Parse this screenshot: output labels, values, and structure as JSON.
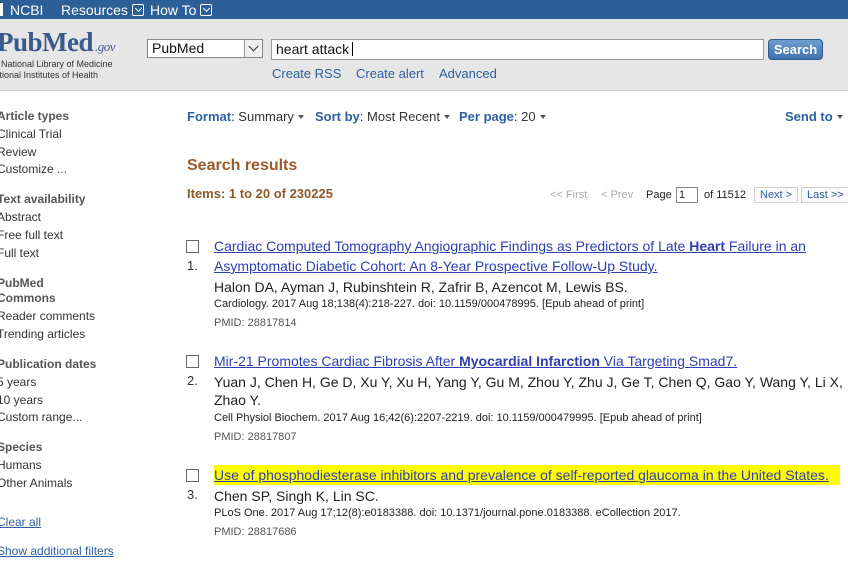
{
  "topbar": {
    "ncbi": "NCBI",
    "resources": "Resources",
    "howto": "How To"
  },
  "logo": {
    "name": "PubMed",
    "suffix": ".gov",
    "org1": "US National Library of Medicine",
    "org2": "National Institutes of Health"
  },
  "search": {
    "database": "PubMed",
    "query": "heart attack",
    "button": "Search"
  },
  "sublinks": {
    "rss": "Create RSS",
    "alert": "Create alert",
    "advanced": "Advanced"
  },
  "sidebar": {
    "article_types": {
      "heading": "Article types",
      "items": [
        "Clinical Trial",
        "Review",
        "Customize ..."
      ]
    },
    "text_availability": {
      "heading": "Text availability",
      "items": [
        "Abstract",
        "Free full text",
        "Full text"
      ]
    },
    "pubmed_commons": {
      "heading1": "PubMed",
      "heading2": "Commons",
      "items": [
        "Reader comments",
        "Trending articles"
      ]
    },
    "publication_dates": {
      "heading": "Publication dates",
      "items": [
        "5 years",
        "10 years",
        "Custom range..."
      ]
    },
    "species": {
      "heading": "Species",
      "items": [
        "Humans",
        "Other Animals"
      ]
    },
    "clear_all": "Clear all",
    "show_filters": "Show additional filters"
  },
  "toolbar": {
    "format_label": "Format",
    "format_sep": ": ",
    "format_value": "Summary",
    "sort_label": "Sort by",
    "sort_sep": ": ",
    "sort_value": "Most Recent",
    "perpage_label": "Per page",
    "perpage_sep": ": ",
    "perpage_value": "20",
    "sendto": "Send to"
  },
  "results": {
    "title": "Search results",
    "items_label": "Items: 1 to 20 of 230225",
    "pager": {
      "first": "<< First",
      "prev": "< Prev",
      "page_label": "Page",
      "page_value": "1",
      "of_label": "of 11512",
      "next": "Next >",
      "last": "Last >>"
    },
    "entries": [
      {
        "num": "1.",
        "title_a": "Cardiac Computed Tomography Angiographic Findings as Predictors of Late ",
        "title_bold": "Heart",
        "title_b": " Failure in an Asymptomatic Diabetic Cohort: An 8-Year Prospective Follow-Up Study.",
        "authors": "Halon DA, Ayman J, Rubinshtein R, Zafrir B, Azencot M, Lewis BS.",
        "citation": "Cardiology. 2017 Aug 18;138(4):218-227. doi: 10.1159/000478995. [Epub ahead of print]",
        "pmid": "PMID: 28817814"
      },
      {
        "num": "2.",
        "title_a": "Mir-21 Promotes Cardiac Fibrosis After ",
        "title_bold": "Myocardial Infarction",
        "title_b": " Via Targeting Smad7.",
        "authors": "Yuan J, Chen H, Ge D, Xu Y, Xu H, Yang Y, Gu M, Zhou Y, Zhu J, Ge T, Chen Q, Gao Y, Wang Y, Li X, Zhao Y.",
        "citation": "Cell Physiol Biochem. 2017 Aug 16;42(6):2207-2219. doi: 10.1159/000479995. [Epub ahead of print]",
        "pmid": "PMID: 28817807"
      },
      {
        "num": "3.",
        "title_a": "Use of phosphodiesterase inhibitors and prevalence of self-reported glaucoma in the United States.",
        "authors": "Chen SP, Singh K, Lin SC.",
        "citation": "PLoS One. 2017 Aug 17;12(8):e0183388. doi: 10.1371/journal.pone.0183388. eCollection 2017.",
        "pmid": "PMID: 28817686"
      }
    ]
  }
}
